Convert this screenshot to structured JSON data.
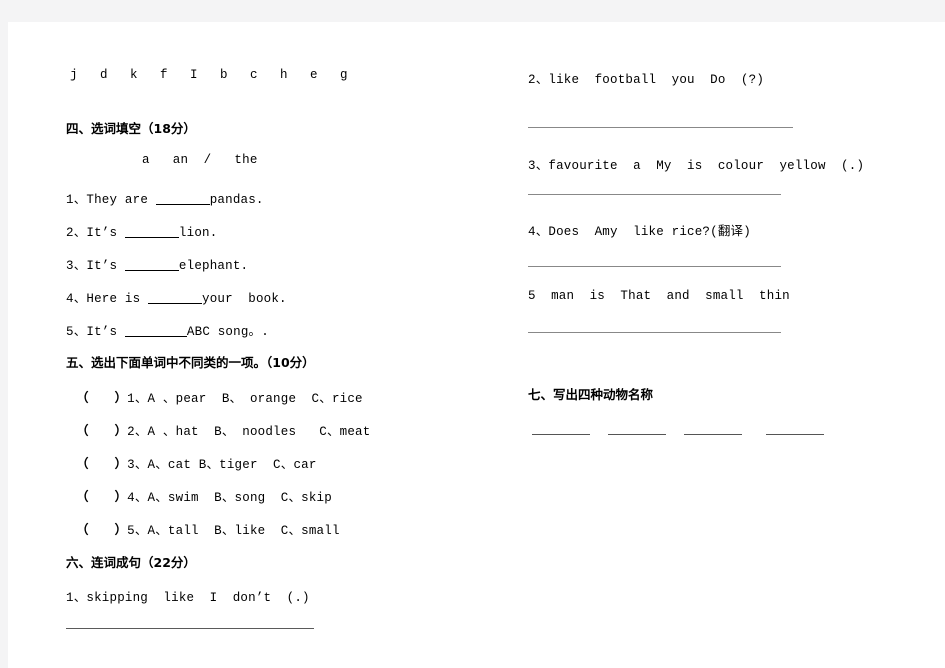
{
  "document": {
    "type": "worksheet",
    "page_background": "#ffffff",
    "canvas_background": "#f4f4f5"
  },
  "left_column": {
    "letters_row": "j   d   k   f   I   b   c   h   e   g",
    "section_four": {
      "heading": "四、选词填空（18分）",
      "word_bank": "a   an  /   the",
      "items": [
        {
          "number": "1、",
          "before": "They are ",
          "after": "pandas."
        },
        {
          "number": "2、",
          "before": "It’s ",
          "after": "lion."
        },
        {
          "number": "3、",
          "before": "It’s ",
          "after": "elephant."
        },
        {
          "number": "4、",
          "before": "Here is ",
          "after": "your  book."
        },
        {
          "number": "5、",
          "before": "It’s ",
          "after": "ABC song。."
        }
      ]
    },
    "section_five": {
      "heading": "五、选出下面单词中不同类的一项。（10分）",
      "items": [
        {
          "bracket": "（      ）",
          "number": "1、",
          "options": "A 、pear  B、 orange  C、rice"
        },
        {
          "bracket": "（      ）",
          "number": "2、",
          "options": "A 、hat  B、 noodles   C、meat"
        },
        {
          "bracket": "（      ）",
          "number": "3、",
          "options": "A、cat B、tiger  C、car"
        },
        {
          "bracket": "（      ）",
          "number": "4、",
          "options": "A、swim  B、song  C、skip"
        },
        {
          "bracket": "（      ）",
          "number": "5、",
          "options": "A、tall  B、like  C、small"
        }
      ]
    },
    "section_six": {
      "heading": "六、连词成句（22分）",
      "item_1": "1、skipping  like  I  don’t  (.)"
    }
  },
  "right_column": {
    "section_six_continued": {
      "item_2": "2、like  football  you  Do  (?)",
      "item_3": "3、favourite  a  My  is  colour  yellow  (.)",
      "item_4": "4、Does  Amy  like rice?(翻译)",
      "item_5": "5  man  is  That  and  small  thin"
    },
    "section_seven": {
      "heading": "七、写出四种动物名称",
      "answer_blank_count": 4
    }
  }
}
